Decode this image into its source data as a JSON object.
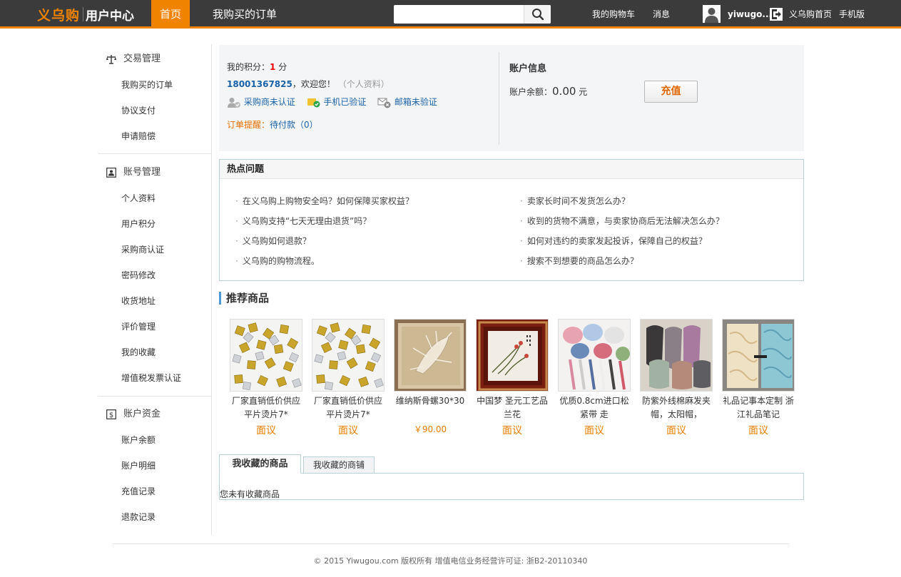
{
  "header": {
    "logo": "义乌购",
    "subtitle": "用户中心",
    "nav_home": "首页",
    "nav_orders": "我购买的订单",
    "search_placeholder": "",
    "cart": "我的购物车",
    "messages": "消息",
    "username": "yiwugo...",
    "site_home": "义乌购首页",
    "mobile": "手机版"
  },
  "sidebar": {
    "groups": [
      {
        "title": "交易管理",
        "items": [
          "我购买的订单",
          "协议支付",
          "申请赔偿"
        ]
      },
      {
        "title": "账号管理",
        "items": [
          "个人资料",
          "用户积分",
          "采购商认证",
          "密码修改",
          "收货地址",
          "评价管理",
          "我的收藏",
          "增值税发票认证"
        ]
      },
      {
        "title": "账户资金",
        "items": [
          "账户余额",
          "账户明细",
          "充值记录",
          "退款记录"
        ]
      }
    ]
  },
  "account": {
    "points_label": "我的积分：",
    "points_value": "1",
    "points_unit": "分",
    "phone": "18001367825",
    "welcome": "，欢迎您！",
    "profile_link": "（个人资料）",
    "buyer_cert": "采购商未认证",
    "phone_verified": "手机已验证",
    "email_unverified": "邮箱未验证",
    "order_reminder_label": "订单提醒：",
    "order_reminder_value": "待付款（0）",
    "info_title": "账户信息",
    "balance_label": "账户余额：",
    "balance_value": "0.00",
    "balance_unit": "元",
    "recharge": "充值"
  },
  "hot": {
    "title": "热点问题",
    "left": [
      "在义乌购上购物安全吗？如何保障买家权益？",
      "义乌购支持“七天无理由退货”吗？",
      "义乌购如何退款？",
      "义乌购的购物流程。"
    ],
    "right": [
      "卖家长时间不发货怎么办？",
      "收到的货物不满意，与卖家协商后无法解决怎么办？",
      "如何对违约的卖家发起投诉，保障自己的权益？",
      "搜索不到想要的商品怎么办？"
    ]
  },
  "recommend": {
    "title": "推荐商品",
    "products": [
      {
        "name": "厂家直销低价供应平片烫片7*",
        "price": "面议"
      },
      {
        "name": "厂家直销低价供应平片烫片7*",
        "price": "面议"
      },
      {
        "name": "维纳斯骨螺30*30",
        "price": "￥90.00"
      },
      {
        "name": "中国梦 圣元工艺品 兰花",
        "price": "面议"
      },
      {
        "name": "优质0.8cm进口松紧带 走",
        "price": "面议"
      },
      {
        "name": "防紫外线棉麻发夹帽，太阳帽，",
        "price": "面议"
      },
      {
        "name": "礼品记事本定制 浙江礼品笔记",
        "price": "面议"
      }
    ]
  },
  "favorites": {
    "tab_goods": "我收藏的商品",
    "tab_shops": "我收藏的商铺",
    "empty": "您未有收藏商品"
  },
  "footer": {
    "text": "© 2015 Yiwugou.com 版权所有 增值电信业务经营许可证: 浙B2-20110340"
  },
  "colors": {
    "brand": "#f08300",
    "topbar": "#3b3b3b",
    "link": "#1b63a8"
  }
}
